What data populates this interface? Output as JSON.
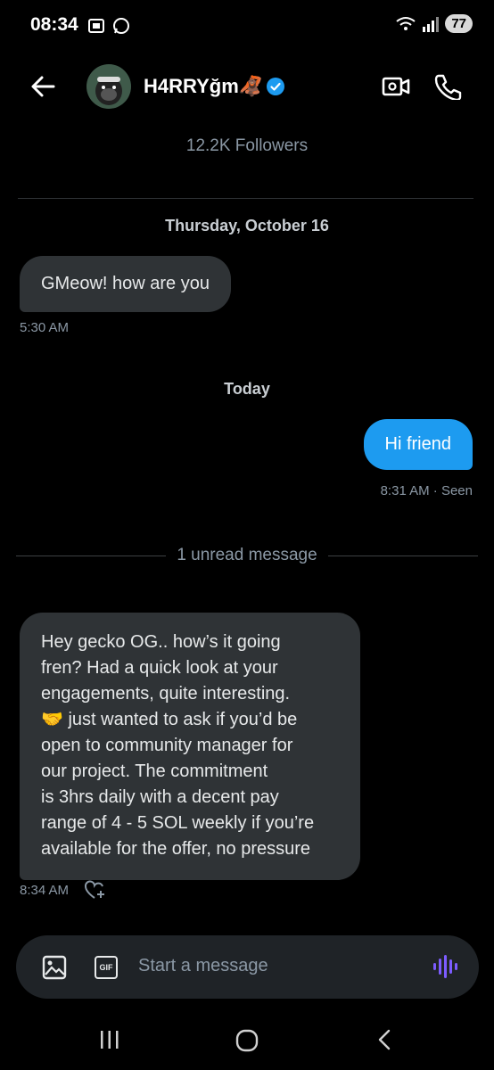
{
  "status_bar": {
    "time": "08:34",
    "battery": "77"
  },
  "header": {
    "name": "H4RRYğm🦧",
    "followers": "12.2K Followers"
  },
  "conversation": {
    "date_1": "Thursday, October 16",
    "msg_1": {
      "text": "GMeow! how are you",
      "time": "5:30 AM"
    },
    "date_2": "Today",
    "msg_2": {
      "text": "Hi friend",
      "time": "8:31 AM · Seen"
    },
    "unread_label": "1 unread message",
    "msg_3": {
      "lines": [
        "Hey gecko OG.. how’s it going",
        "fren? Had a quick look at your",
        "engagements,  quite interesting.",
        "🤝 just wanted to ask if you’d be",
        "open to community manager for",
        "our project. The commitment",
        "is 3hrs daily with a decent pay",
        "range of 4 - 5 SOL weekly if you’re",
        "available for the offer, no pressure"
      ],
      "time": "8:34 AM"
    }
  },
  "composer": {
    "placeholder": "Start a message",
    "gif_label": "GIF"
  },
  "icons": [
    "back-arrow-icon",
    "video-call-icon",
    "phone-icon",
    "verified-badge-icon",
    "heart-plus-icon",
    "image-icon",
    "gif-icon",
    "voice-wave-icon",
    "recent-apps-icon",
    "home-icon",
    "back-nav-icon"
  ],
  "colors": {
    "accent": "#1d9bf0",
    "incoming_bubble": "#2f3336",
    "voice_icon": "#7c5cff"
  }
}
